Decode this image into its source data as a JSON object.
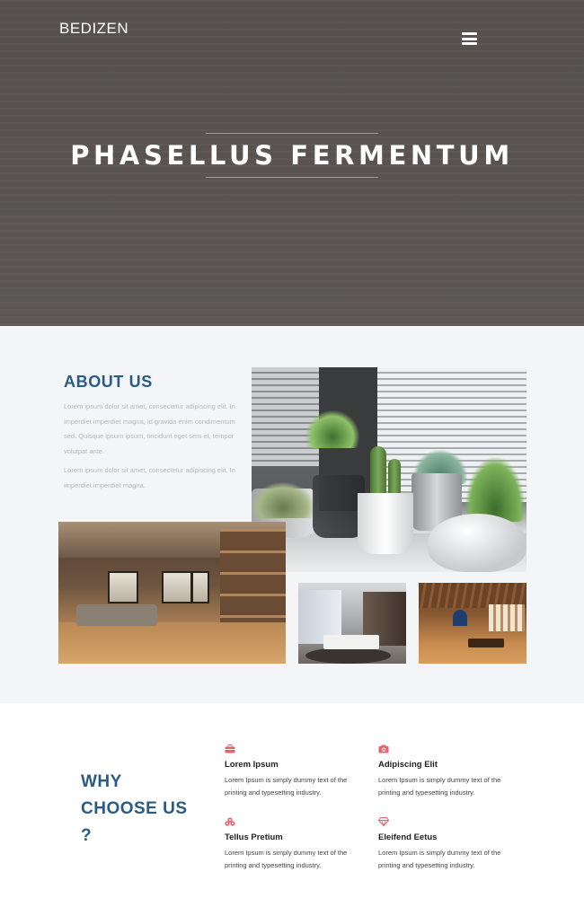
{
  "header": {
    "logo": "BEDIZEN",
    "menu_icon": "hamburger-menu-icon"
  },
  "hero": {
    "title": "PHASELLUS FERMENTUM"
  },
  "about": {
    "title": "ABOUT US",
    "paragraph_1": "Lorem ipsum dolor sit amet, consectetur adipiscing elit. In imperdiet imperdiet magna, id gravida enim condimentum sed. Quisque ipsum ipsum, tincidunt eget sem et, tempor volutpat ante.",
    "paragraph_2": "Lorem ipsum dolor sit amet, consectetur adipiscing elit. In imperdiet imperdiet magna."
  },
  "why": {
    "title": "WHY CHOOSE US ?",
    "accent_color": "#e8626c",
    "features": [
      {
        "icon": "briefcase-icon",
        "title": "Lorem Ipsum",
        "desc": "Lorem Ipsum is simply dummy text of the printing and typesetting industry."
      },
      {
        "icon": "camera-icon",
        "title": "Adipiscing Elit",
        "desc": "Lorem Ipsum is simply dummy text of the printing and typesetting industry."
      },
      {
        "icon": "cubes-icon",
        "title": "Tellus Pretium",
        "desc": "Lorem Ipsum is simply dummy text of the printing and typesetting industry."
      },
      {
        "icon": "diamond-icon",
        "title": "Eleifend Eetus",
        "desc": "Lorem Ipsum is simply dummy text of the printing and typesetting industry."
      }
    ]
  },
  "colors": {
    "hero_bg": "#58534f",
    "heading_blue": "#2a5b86",
    "about_bg": "#f4f5f6"
  }
}
